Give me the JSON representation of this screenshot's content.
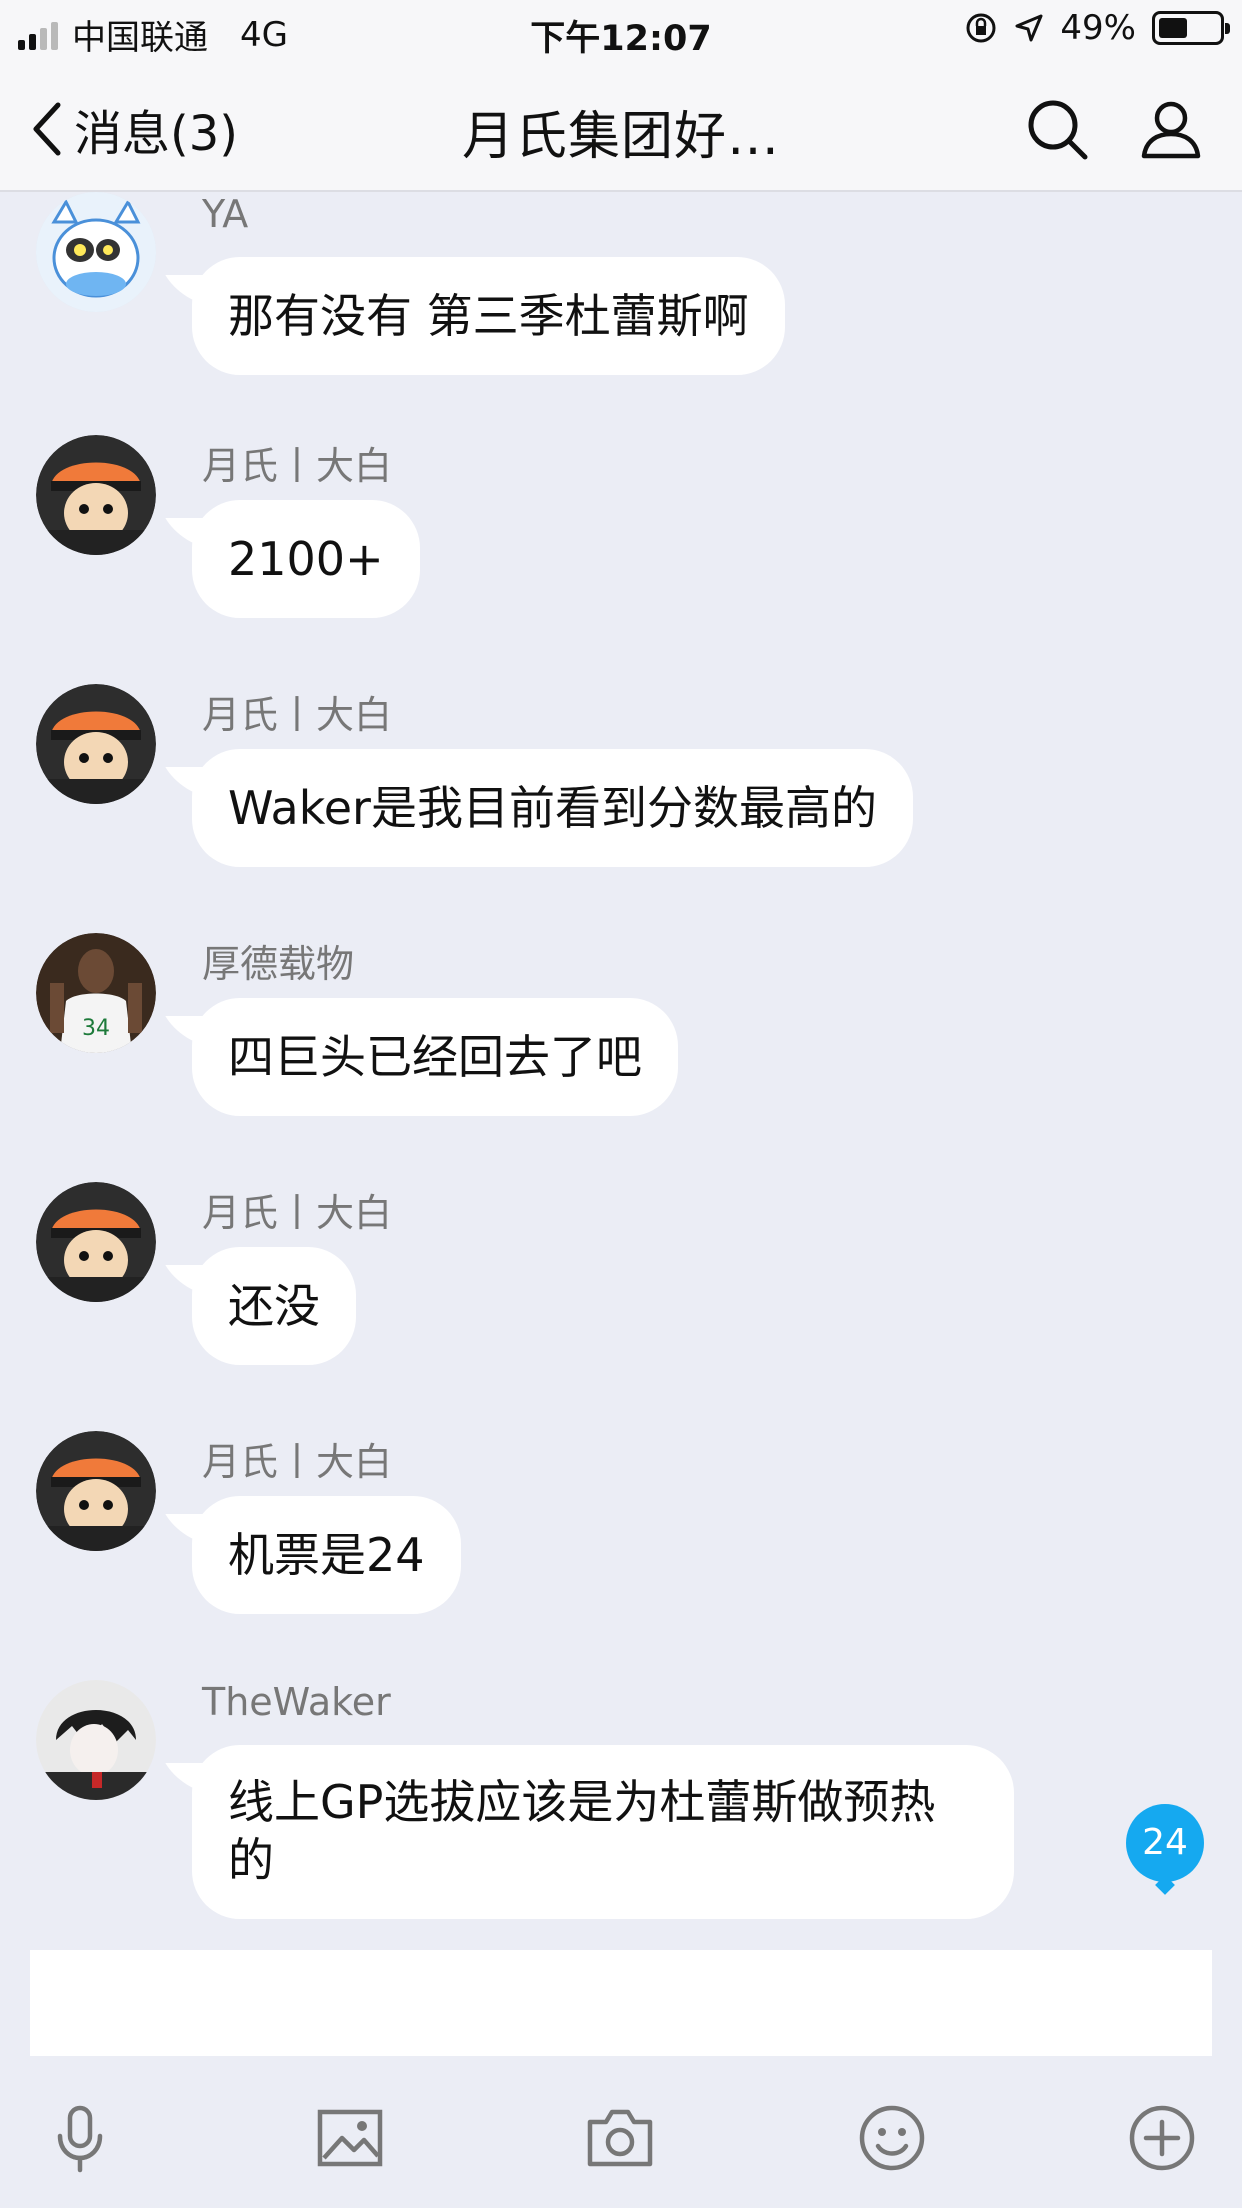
{
  "status_bar": {
    "carrier": "中国联通",
    "network": "4G",
    "time": "下午12:07",
    "battery_percent": "49%",
    "battery_level": 0.49
  },
  "nav": {
    "back_label": "消息(3)",
    "title": "月氏集团好…",
    "search_icon": "search-icon",
    "members_icon": "person-icon"
  },
  "messages": [
    {
      "sender": "YA",
      "text": "那有没有 第三季杜蕾斯啊",
      "avatar": "cartoon-cat"
    },
    {
      "sender": "月氏丨大白",
      "text": "2100+",
      "avatar": "cartoon-orange-hat"
    },
    {
      "sender": "月氏丨大白",
      "text": "Waker是我目前看到分数最高的",
      "avatar": "cartoon-orange-hat"
    },
    {
      "sender": "厚德载物",
      "text": "四巨头已经回去了吧",
      "avatar": "basketball-player"
    },
    {
      "sender": "月氏丨大白",
      "text": "还没",
      "avatar": "cartoon-orange-hat"
    },
    {
      "sender": "月氏丨大白",
      "text": "机票是24",
      "avatar": "cartoon-orange-hat"
    },
    {
      "sender": "TheWaker",
      "text_line1": "线上GP选拔应该是为杜蕾斯做预热",
      "text_line2": "的",
      "avatar": "anime-boy"
    }
  ],
  "unread_badge": "24",
  "input": {
    "value": "",
    "placeholder": ""
  },
  "toolbar": [
    "microphone-icon",
    "image-icon",
    "camera-icon",
    "emoji-icon",
    "plus-icon"
  ],
  "colors": {
    "background": "#ebedf5",
    "bubble": "#ffffff",
    "badge": "#15a9f0"
  }
}
